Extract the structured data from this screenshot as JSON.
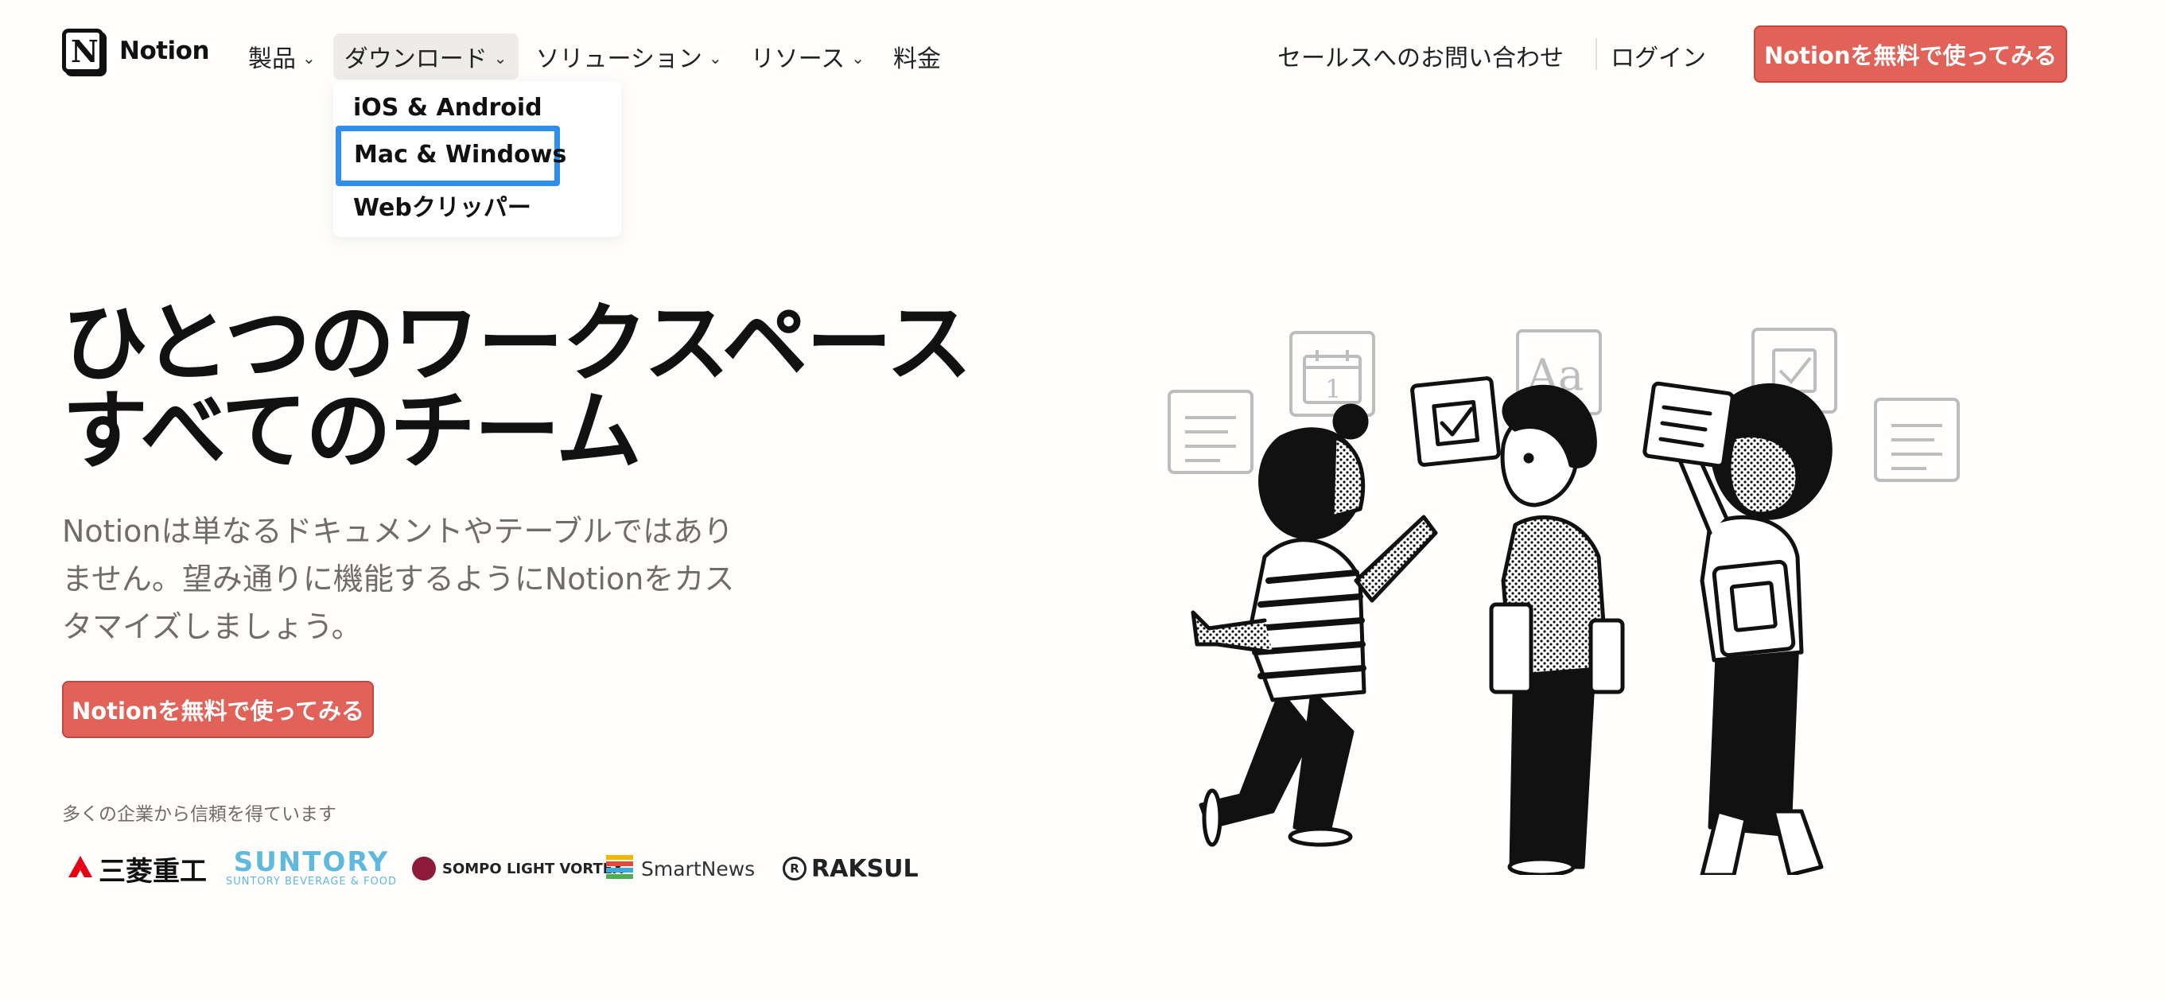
{
  "header": {
    "logo_text": "Notion",
    "logo_letter": "N",
    "nav": [
      {
        "label": "製品",
        "has_chevron": true,
        "active": false
      },
      {
        "label": "ダウンロード",
        "has_chevron": true,
        "active": true
      },
      {
        "label": "ソリューション",
        "has_chevron": true,
        "active": false
      },
      {
        "label": "リソース",
        "has_chevron": true,
        "active": false
      },
      {
        "label": "料金",
        "has_chevron": false,
        "active": false
      }
    ],
    "sales_link": "セールスへのお問い合わせ",
    "login_link": "ログイン",
    "cta": "Notionを無料で使ってみる"
  },
  "dropdown": {
    "items": [
      "iOS & Android",
      "Mac & Windows",
      "Webクリッパー"
    ],
    "highlighted": "Mac & Windows"
  },
  "hero": {
    "title_line1": "ひとつのワークスペース",
    "title_line2": "すべてのチーム",
    "description": "Notionは単なるドキュメントやテーブルではありません。望み通りに機能するようにNotionをカスタマイズしましょう。",
    "cta": "Notionを無料で使ってみる"
  },
  "trusted": {
    "label": "多くの企業から信頼を得ています",
    "logos": {
      "mhi": "三菱重工",
      "suntory": "SUNTORY",
      "suntory_sub": "SUNTORY BEVERAGE & FOOD",
      "sompo": "SOMPO LIGHT VORTEX",
      "smartnews": "SmartNews",
      "raksul": "RAKSUL",
      "raksul_mark": "R"
    }
  },
  "illustration": {
    "glyph_text": "Aa",
    "calendar_number": "1"
  },
  "colors": {
    "accent": "#e16259",
    "highlight": "#2f8ef0",
    "background": "#fffefc",
    "muted_text": "#6f6d69"
  }
}
